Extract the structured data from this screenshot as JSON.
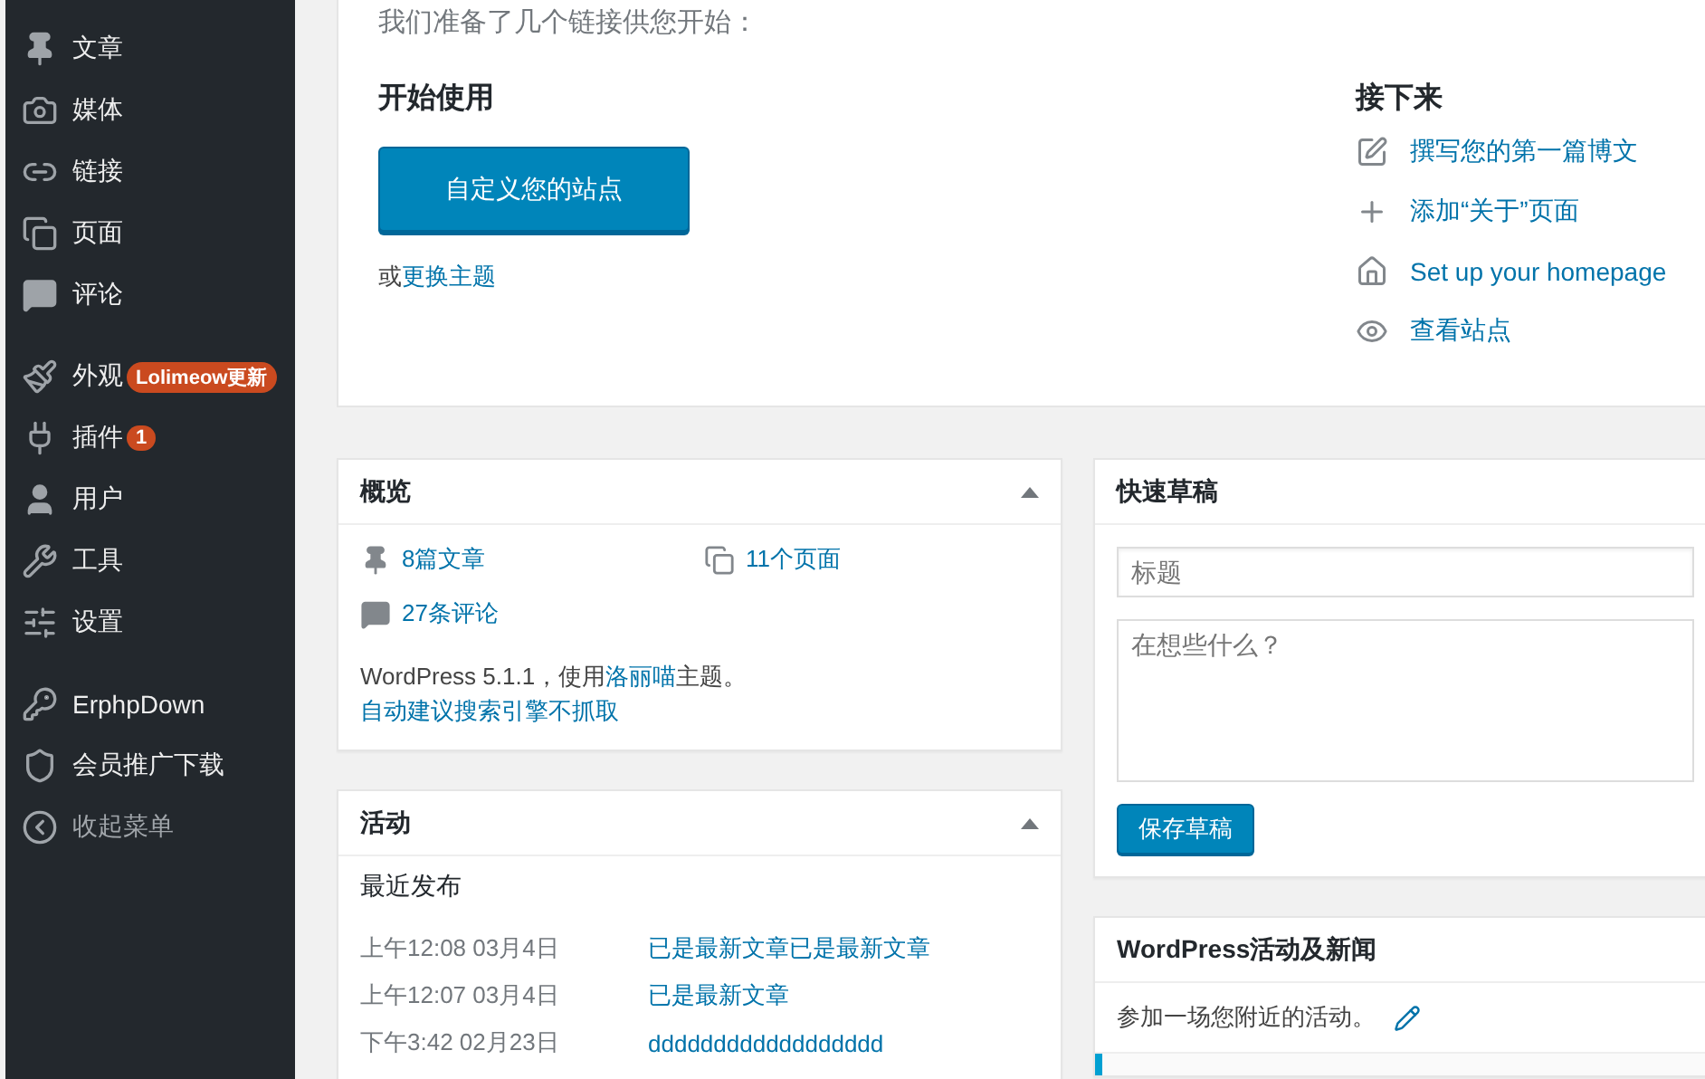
{
  "sidebar": {
    "groups": [
      {
        "items": [
          {
            "label": "文章",
            "kind": "menu"
          },
          {
            "label": "媒体",
            "kind": "menu"
          },
          {
            "label": "链接",
            "kind": "menu"
          },
          {
            "label": "页面",
            "kind": "menu"
          },
          {
            "label": "评论",
            "kind": "menu"
          }
        ]
      },
      {
        "items": [
          {
            "label": "外观",
            "kind": "menu",
            "badge": "Lolimeow更新"
          },
          {
            "label": "插件",
            "kind": "menu",
            "badge": "1"
          },
          {
            "label": "用户",
            "kind": "menu"
          },
          {
            "label": "工具",
            "kind": "menu"
          },
          {
            "label": "设置",
            "kind": "menu"
          }
        ]
      },
      {
        "items": [
          {
            "label": "ErphpDown",
            "kind": "menu"
          },
          {
            "label": "会员推广下载",
            "kind": "menu"
          },
          {
            "label": "收起菜单",
            "kind": "collapse"
          }
        ]
      }
    ]
  },
  "welcome": {
    "intro": "我们准备了几个链接供您开始：",
    "get_started": {
      "heading": "开始使用",
      "button": "自定义您的站点",
      "alt_prefix": "或",
      "alt_link": "更换主题"
    },
    "next_steps": {
      "heading": "接下来",
      "links": [
        "撰写您的第一篇博文",
        "添加“关于”页面",
        "Set up your homepage",
        "查看站点"
      ]
    }
  },
  "overview": {
    "title": "概览",
    "stats": [
      "8篇文章",
      "11个页面",
      "27条评论"
    ],
    "version_before": "WordPress 5.1.1，使用",
    "theme_link": "洛丽喵",
    "version_after": "主题。",
    "search_link": "自动建议搜索引擎不抓取"
  },
  "activity": {
    "title": "活动",
    "subheading": "最近发布",
    "rows": [
      {
        "date": "上午12:08 03月4日",
        "title": "已是最新文章已是最新文章"
      },
      {
        "date": "上午12:07 03月4日",
        "title": "已是最新文章"
      },
      {
        "date": "下午3:42 02月23日",
        "title": "dddddddddddddddddd"
      }
    ]
  },
  "quick_draft": {
    "title": "快速草稿",
    "title_field": {
      "placeholder": "标题"
    },
    "content_field": {
      "placeholder": "在想些什么？"
    },
    "button": "保存草稿"
  },
  "news": {
    "title": "WordPress活动及新闻",
    "text": "参加一场您附近的活动。"
  }
}
